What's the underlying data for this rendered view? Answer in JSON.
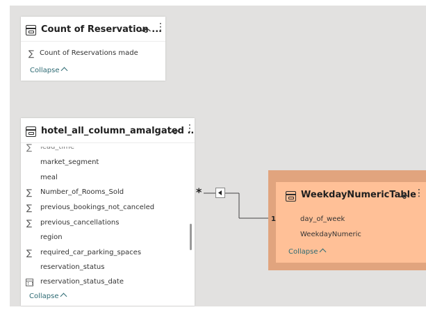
{
  "cards": {
    "count_reservations": {
      "title": "Count of Reservation ...",
      "fields": [
        "Count of Reservations made"
      ],
      "collapse_label": "Collapse"
    },
    "hotel": {
      "title": "hotel_all_column_amalgated ...",
      "partial_field": "lead_time",
      "fields": [
        {
          "name": "market_segment",
          "type": "text"
        },
        {
          "name": "meal",
          "type": "text"
        },
        {
          "name": "Number_of_Rooms_Sold",
          "type": "measure"
        },
        {
          "name": "previous_bookings_not_canceled",
          "type": "measure"
        },
        {
          "name": "previous_cancellations",
          "type": "measure"
        },
        {
          "name": "region",
          "type": "text"
        },
        {
          "name": "required_car_parking_spaces",
          "type": "measure"
        },
        {
          "name": "reservation_status",
          "type": "text"
        },
        {
          "name": "reservation_status_date",
          "type": "date"
        }
      ],
      "collapse_label": "Collapse"
    },
    "weekday": {
      "title": "WeekdayNumericTable",
      "fields": [
        "day_of_week",
        "WeekdayNumeric"
      ],
      "collapse_label": "Collapse"
    }
  },
  "relationship": {
    "from_cardinality": "*",
    "to_cardinality": "1"
  },
  "icons": {
    "table": "table-icon",
    "visibility": "eye-icon",
    "more": "more-options-icon",
    "measure": "sigma-icon",
    "date": "calendar-icon",
    "filter_direction": "arrow-left-icon"
  },
  "colors": {
    "canvas": "#e2e1e0",
    "selected_frame": "#e1a47e",
    "selected_card": "#ffc097",
    "collapse_link": "#2d6a73"
  }
}
